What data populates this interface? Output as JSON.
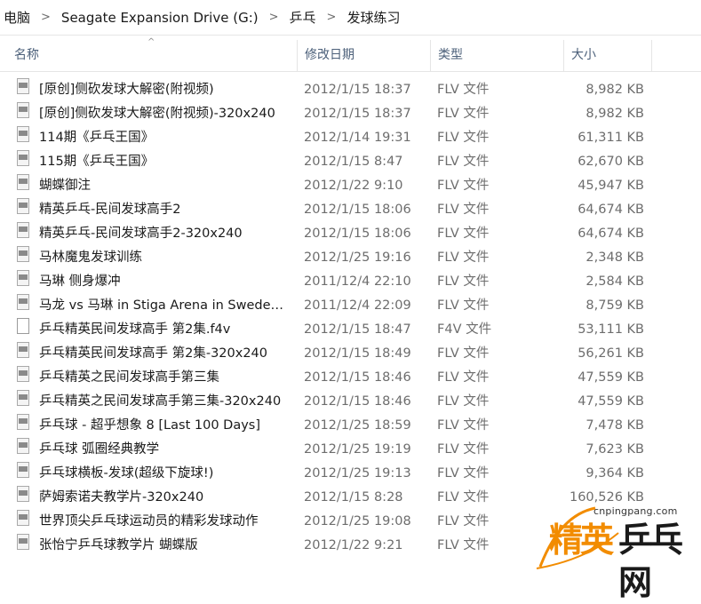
{
  "breadcrumb": [
    "电脑",
    "Seagate Expansion Drive (G:)",
    "乒乓",
    "发球练习"
  ],
  "breadcrumb_separator": ">",
  "columns": {
    "name": "名称",
    "date": "修改日期",
    "type": "类型",
    "size": "大小"
  },
  "sort_indicator": "^",
  "files": [
    {
      "name": "[原创]侧砍发球大解密(附视频)",
      "date": "2012/1/15 18:37",
      "type": "FLV 文件",
      "size": "8,982 KB",
      "icon": "flv-file-icon"
    },
    {
      "name": "[原创]侧砍发球大解密(附视频)-320x240",
      "date": "2012/1/15 18:37",
      "type": "FLV 文件",
      "size": "8,982 KB",
      "icon": "flv-file-icon"
    },
    {
      "name": "114期《乒乓王国》",
      "date": "2012/1/14 19:31",
      "type": "FLV 文件",
      "size": "61,311 KB",
      "icon": "flv-file-icon"
    },
    {
      "name": "115期《乒乓王国》",
      "date": "2012/1/15 8:47",
      "type": "FLV 文件",
      "size": "62,670 KB",
      "icon": "flv-file-icon"
    },
    {
      "name": "蝴蝶御注",
      "date": "2012/1/22 9:10",
      "type": "FLV 文件",
      "size": "45,947 KB",
      "icon": "flv-file-icon"
    },
    {
      "name": "精英乒乓-民间发球高手2",
      "date": "2012/1/15 18:06",
      "type": "FLV 文件",
      "size": "64,674 KB",
      "icon": "flv-file-icon"
    },
    {
      "name": "精英乒乓-民间发球高手2-320x240",
      "date": "2012/1/15 18:06",
      "type": "FLV 文件",
      "size": "64,674 KB",
      "icon": "flv-file-icon"
    },
    {
      "name": "马林魔鬼发球训练",
      "date": "2012/1/25 19:16",
      "type": "FLV 文件",
      "size": "2,348 KB",
      "icon": "flv-file-icon"
    },
    {
      "name": "马琳 侧身爆冲",
      "date": "2011/12/4 22:10",
      "type": "FLV 文件",
      "size": "2,584 KB",
      "icon": "flv-file-icon"
    },
    {
      "name": "马龙 vs 马琳 in Stiga Arena in Sweden...",
      "date": "2011/12/4 22:09",
      "type": "FLV 文件",
      "size": "8,759 KB",
      "icon": "flv-file-icon"
    },
    {
      "name": "乒乓精英民间发球高手 第2集.f4v",
      "date": "2012/1/15 18:47",
      "type": "F4V 文件",
      "size": "53,111 KB",
      "icon": "blank-file-icon"
    },
    {
      "name": "乒乓精英民间发球高手 第2集-320x240",
      "date": "2012/1/15 18:49",
      "type": "FLV 文件",
      "size": "56,261 KB",
      "icon": "flv-file-icon"
    },
    {
      "name": "乒乓精英之民间发球高手第三集",
      "date": "2012/1/15 18:46",
      "type": "FLV 文件",
      "size": "47,559 KB",
      "icon": "flv-file-icon"
    },
    {
      "name": "乒乓精英之民间发球高手第三集-320x240",
      "date": "2012/1/15 18:46",
      "type": "FLV 文件",
      "size": "47,559 KB",
      "icon": "flv-file-icon"
    },
    {
      "name": "乒乓球 - 超乎想象 8 [Last 100 Days]",
      "date": "2012/1/25 18:59",
      "type": "FLV 文件",
      "size": "7,478 KB",
      "icon": "flv-file-icon"
    },
    {
      "name": "乒乓球 弧圈经典教学",
      "date": "2012/1/25 19:19",
      "type": "FLV 文件",
      "size": "7,623 KB",
      "icon": "flv-file-icon"
    },
    {
      "name": "乒乓球横板-发球(超级下旋球!)",
      "date": "2012/1/25 19:13",
      "type": "FLV 文件",
      "size": "9,364 KB",
      "icon": "flv-file-icon"
    },
    {
      "name": "萨姆索诺夫教学片-320x240",
      "date": "2012/1/15 8:28",
      "type": "FLV 文件",
      "size": "160,526 KB",
      "icon": "flv-file-icon"
    },
    {
      "name": "世界顶尖乒乓球运动员的精彩发球动作",
      "date": "2012/1/25 19:08",
      "type": "FLV 文件",
      "size": "",
      "icon": "flv-file-icon"
    },
    {
      "name": "张怡宁乒乓球教学片 蝴蝶版",
      "date": "2012/1/22 9:21",
      "type": "FLV 文件",
      "size": "",
      "icon": "flv-file-icon"
    }
  ],
  "watermark": {
    "site": "cnpingpang.com",
    "text_a": "精英",
    "text_b": "乒乓网",
    "colors": {
      "accent": "#f28c00",
      "dark": "#1a1a1a"
    }
  }
}
